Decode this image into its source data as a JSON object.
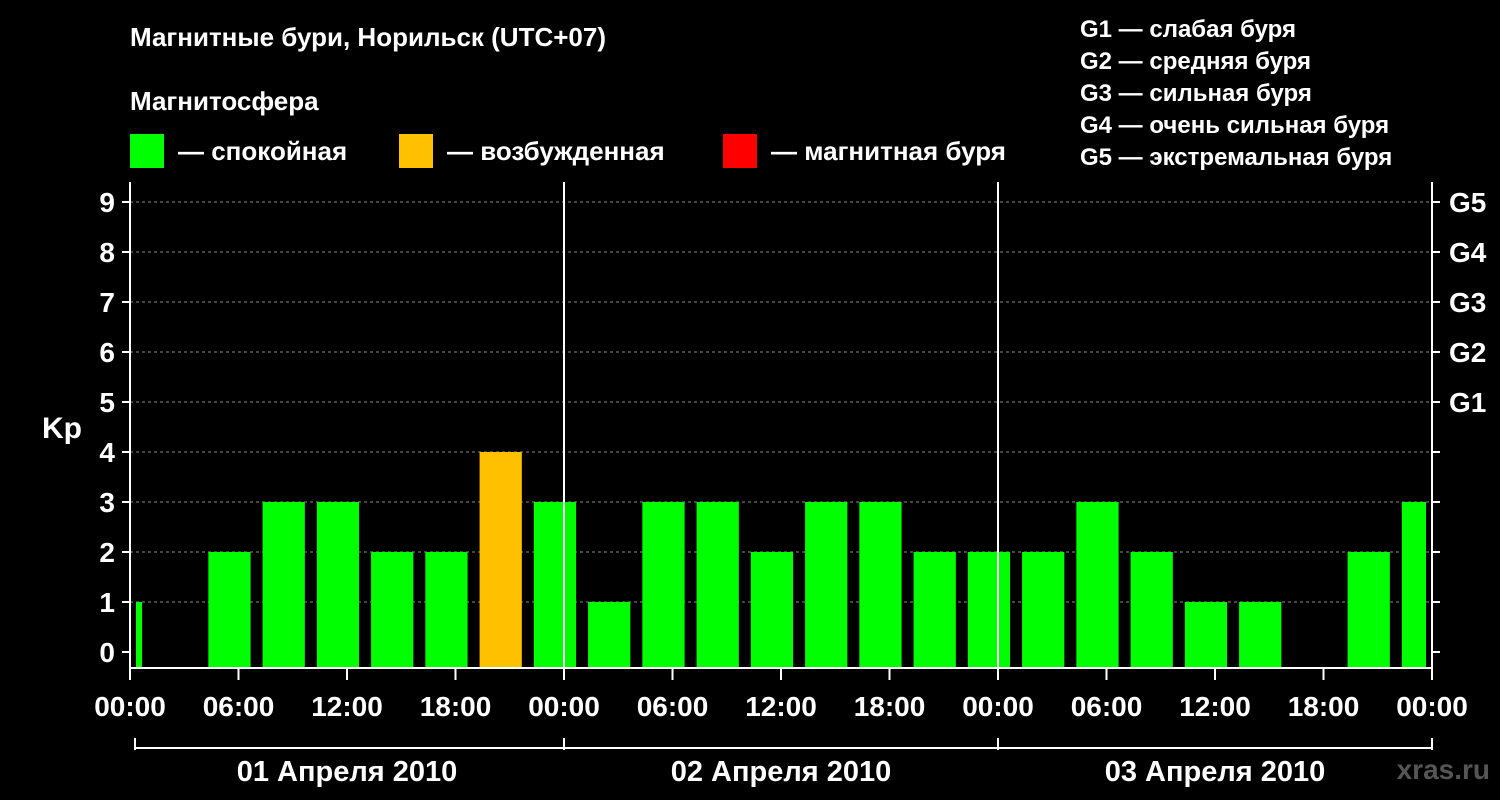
{
  "title": "Магнитные бури, Норильск (UTC+07)",
  "magnetosphere_label": "Магнитосфера",
  "legend": [
    {
      "label": "— спокойная",
      "color": "#00ff00"
    },
    {
      "label": "— возбужденная",
      "color": "#ffc000"
    },
    {
      "label": "— магнитная буря",
      "color": "#ff0000"
    }
  ],
  "g_scale": [
    "G1 — слабая буря",
    "G2 — средняя буря",
    "G3 — сильная буря",
    "G4 — очень сильная буря",
    "G5 — экстремальная буря"
  ],
  "watermark": "xras.ru",
  "chart_data": {
    "type": "bar",
    "ylabel": "Kp",
    "ylim": [
      0,
      9
    ],
    "yticks": [
      0,
      1,
      2,
      3,
      4,
      5,
      6,
      7,
      8,
      9
    ],
    "right_ticks": [
      {
        "value": 5,
        "label": "G1"
      },
      {
        "value": 6,
        "label": "G2"
      },
      {
        "value": 7,
        "label": "G3"
      },
      {
        "value": 8,
        "label": "G4"
      },
      {
        "value": 9,
        "label": "G5"
      }
    ],
    "x_ticks": [
      "00:00",
      "06:00",
      "12:00",
      "18:00",
      "00:00",
      "06:00",
      "12:00",
      "18:00",
      "00:00",
      "06:00",
      "12:00",
      "18:00",
      "00:00"
    ],
    "days": [
      "01 Апреля 2010",
      "02 Апреля 2010",
      "03 Апреля 2010"
    ],
    "grid": true,
    "colors": {
      "quiet": "#00ff00",
      "active": "#ffc000",
      "storm": "#ff0000"
    },
    "series": [
      {
        "date": "01 Апреля 2010",
        "start": "00:00",
        "hours": 1,
        "value": 1
      },
      {
        "date": "01 Апреля 2010",
        "start": "01:00",
        "hours": 3,
        "value": 0
      },
      {
        "date": "01 Апреля 2010",
        "start": "04:00",
        "hours": 3,
        "value": 2
      },
      {
        "date": "01 Апреля 2010",
        "start": "07:00",
        "hours": 3,
        "value": 3
      },
      {
        "date": "01 Апреля 2010",
        "start": "10:00",
        "hours": 3,
        "value": 3
      },
      {
        "date": "01 Апреля 2010",
        "start": "13:00",
        "hours": 3,
        "value": 2
      },
      {
        "date": "01 Апреля 2010",
        "start": "16:00",
        "hours": 3,
        "value": 2
      },
      {
        "date": "01 Апреля 2010",
        "start": "19:00",
        "hours": 3,
        "value": 4
      },
      {
        "date": "01 Апреля 2010",
        "start": "22:00",
        "hours": 3,
        "value": 3
      },
      {
        "date": "02 Апреля 2010",
        "start": "01:00",
        "hours": 3,
        "value": 1
      },
      {
        "date": "02 Апреля 2010",
        "start": "04:00",
        "hours": 3,
        "value": 3
      },
      {
        "date": "02 Апреля 2010",
        "start": "07:00",
        "hours": 3,
        "value": 3
      },
      {
        "date": "02 Апреля 2010",
        "start": "10:00",
        "hours": 3,
        "value": 2
      },
      {
        "date": "02 Апреля 2010",
        "start": "13:00",
        "hours": 3,
        "value": 3
      },
      {
        "date": "02 Апреля 2010",
        "start": "16:00",
        "hours": 3,
        "value": 3
      },
      {
        "date": "02 Апреля 2010",
        "start": "19:00",
        "hours": 3,
        "value": 2
      },
      {
        "date": "02 Апреля 2010",
        "start": "22:00",
        "hours": 3,
        "value": 2
      },
      {
        "date": "03 Апреля 2010",
        "start": "01:00",
        "hours": 3,
        "value": 2
      },
      {
        "date": "03 Апреля 2010",
        "start": "04:00",
        "hours": 3,
        "value": 3
      },
      {
        "date": "03 Апреля 2010",
        "start": "07:00",
        "hours": 3,
        "value": 2
      },
      {
        "date": "03 Апреля 2010",
        "start": "10:00",
        "hours": 3,
        "value": 1
      },
      {
        "date": "03 Апреля 2010",
        "start": "13:00",
        "hours": 3,
        "value": 1
      },
      {
        "date": "03 Апреля 2010",
        "start": "16:00",
        "hours": 3,
        "value": 0
      },
      {
        "date": "03 Апреля 2010",
        "start": "19:00",
        "hours": 3,
        "value": 2
      },
      {
        "date": "03 Апреля 2010",
        "start": "22:00",
        "hours": 2,
        "value": 3
      }
    ]
  }
}
